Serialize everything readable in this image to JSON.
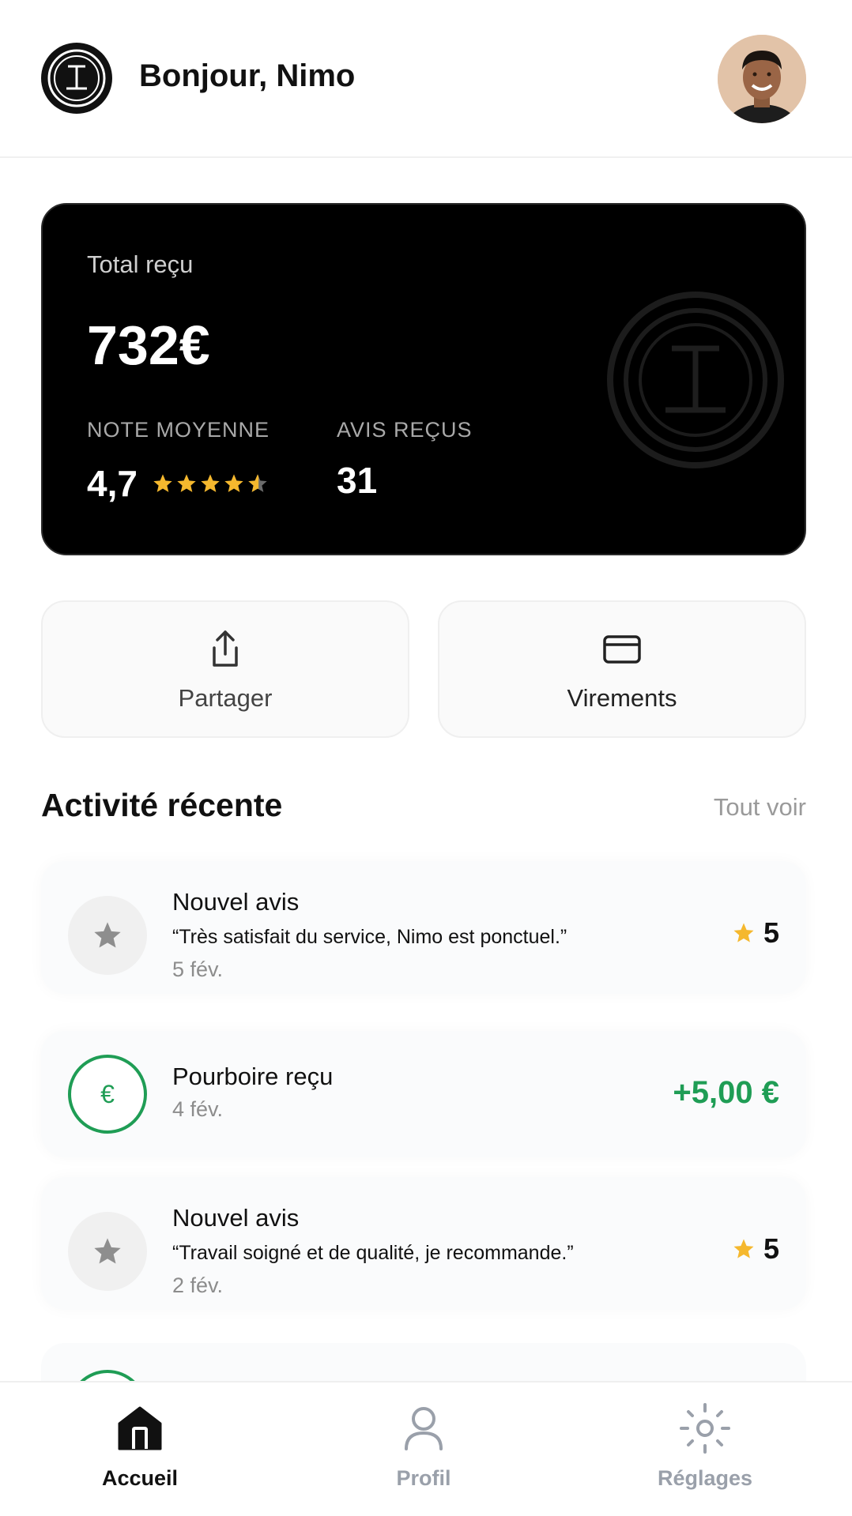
{
  "header": {
    "greeting": "Bonjour, Nimo",
    "logo_icon": "brand-logo-icon",
    "avatar_icon": "user-avatar"
  },
  "summary": {
    "total_label": "Total reçu",
    "total_value": "732€",
    "rating_label": "NOTE MOYENNE",
    "rating_value": "4,7",
    "rating_stars": 4.7,
    "reviews_label": "AVIS REÇUS",
    "reviews_value": "31"
  },
  "actions": {
    "share_label": "Partager",
    "share_icon": "share-icon",
    "transfers_label": "Virements",
    "transfers_icon": "card-icon"
  },
  "activity": {
    "title": "Activité récente",
    "see_all": "Tout voir",
    "items": [
      {
        "type": "review",
        "title": "Nouvel avis",
        "quote": "“Très satisfait du service, Nimo est ponctuel.”",
        "date": "5 fév.",
        "rating": "5"
      },
      {
        "type": "tip",
        "title": "Pourboire reçu",
        "icon_glyph": "€",
        "date": "4 fév.",
        "amount": "+5,00 €"
      },
      {
        "type": "review",
        "title": "Nouvel avis",
        "quote": "“Travail soigné et de qualité, je recommande.”",
        "date": "2 fév.",
        "rating": "5"
      }
    ]
  },
  "nav": {
    "home_label": "Accueil",
    "profile_label": "Profil",
    "settings_label": "Réglages"
  },
  "colors": {
    "accent_green": "#1f9d55",
    "star_yellow": "#f5b82e",
    "card_black": "#000000"
  }
}
